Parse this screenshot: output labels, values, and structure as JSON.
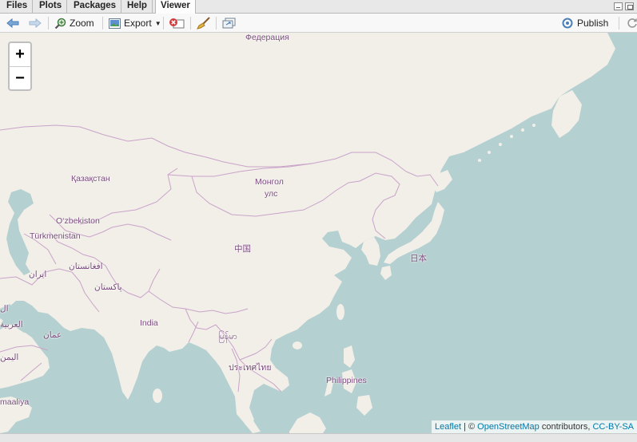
{
  "tabs": [
    {
      "label": "Files",
      "active": false
    },
    {
      "label": "Plots",
      "active": false
    },
    {
      "label": "Packages",
      "active": false
    },
    {
      "label": "Help",
      "active": false
    },
    {
      "label": "Viewer",
      "active": true
    }
  ],
  "toolbar": {
    "back_icon": "arrow-left-icon",
    "forward_icon": "arrow-right-icon",
    "zoom_label": "Zoom",
    "export_label": "Export",
    "remove_icon": "remove-viewer-icon",
    "clear_icon": "broom-icon",
    "popout_icon": "show-in-window-icon",
    "publish_label": "Publish",
    "refresh_icon": "refresh-icon"
  },
  "map": {
    "zoom_in_label": "+",
    "zoom_out_label": "−",
    "labels": {
      "federation": "Федерация",
      "kazakhstan": "Қазақстан",
      "mongolia_1": "Монгол",
      "mongolia_2": "улс",
      "uzbekistan": "O‘zbekiston",
      "turkmenistan": "Türkmenistan",
      "afghanistan": "افغانستان",
      "iran": "ایران",
      "pakistan": "پاکستان",
      "china": "中国",
      "japan": "日本",
      "india": "India",
      "myanmar": "မြန်မာ",
      "thailand": "ประเทศไทย",
      "philippines": "Philippines",
      "saudi": "العربية",
      "oman": "عمان",
      "yemen": "اليمن",
      "somalia": "maaliya",
      "iraq": "ال"
    },
    "attribution": {
      "leaflet": "Leaflet",
      "sep": " | © ",
      "osm": "OpenStreetMap",
      "contrib": " contributors, ",
      "license": "CC-BY-SA"
    },
    "colors": {
      "water": "#b5d0d0",
      "land": "#f2efe9",
      "border": "#c9a3c9",
      "label": "#7a4b7c"
    }
  }
}
